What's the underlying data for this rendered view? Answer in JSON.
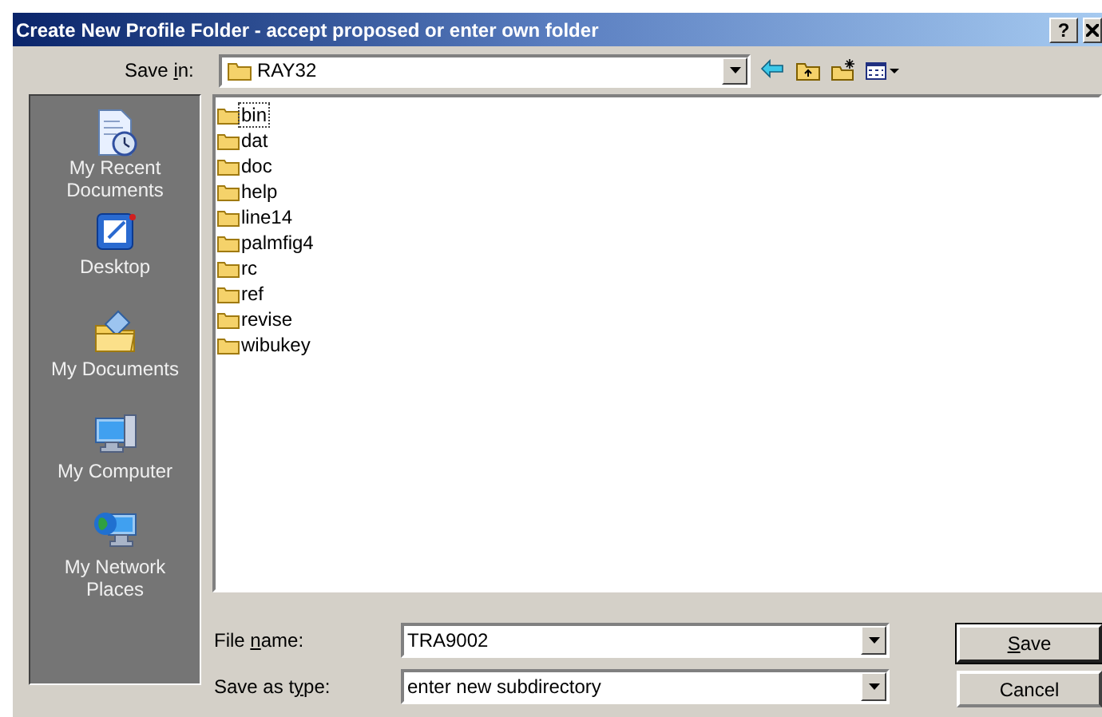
{
  "window": {
    "title": "Create New Profile Folder - accept proposed or enter own folder",
    "help_button": "?"
  },
  "save_in": {
    "label_parts": {
      "before": "Save ",
      "key": "i",
      "after": "n:"
    },
    "value": "RAY32"
  },
  "toolbar": [
    {
      "kind": "back"
    },
    {
      "kind": "up"
    },
    {
      "kind": "new-folder"
    },
    {
      "kind": "views"
    }
  ],
  "places": [
    {
      "kind": "recent",
      "label": "My Recent Documents"
    },
    {
      "kind": "desktop",
      "label": "Desktop"
    },
    {
      "kind": "documents",
      "label": "My Documents"
    },
    {
      "kind": "computer",
      "label": "My Computer"
    },
    {
      "kind": "network",
      "label": "My Network Places"
    }
  ],
  "folders": [
    {
      "name": "bin",
      "selected": true
    },
    {
      "name": "dat",
      "selected": false
    },
    {
      "name": "doc",
      "selected": false
    },
    {
      "name": "help",
      "selected": false
    },
    {
      "name": "line14",
      "selected": false
    },
    {
      "name": "palmfig4",
      "selected": false
    },
    {
      "name": "rc",
      "selected": false
    },
    {
      "name": "ref",
      "selected": false
    },
    {
      "name": "revise",
      "selected": false
    },
    {
      "name": "wibukey",
      "selected": false
    }
  ],
  "file_name": {
    "label_parts": {
      "before": "File ",
      "key": "n",
      "after": "ame:"
    },
    "value": "TRA9002"
  },
  "save_as_type": {
    "label_parts": {
      "before": "Save as t",
      "key": "y",
      "after": "pe:"
    },
    "value": "enter new subdirectory"
  },
  "buttons": [
    {
      "label_parts": {
        "key": "S",
        "after": "ave"
      },
      "default": true
    },
    {
      "label_parts": {
        "before": "Cancel"
      },
      "default": false
    }
  ]
}
